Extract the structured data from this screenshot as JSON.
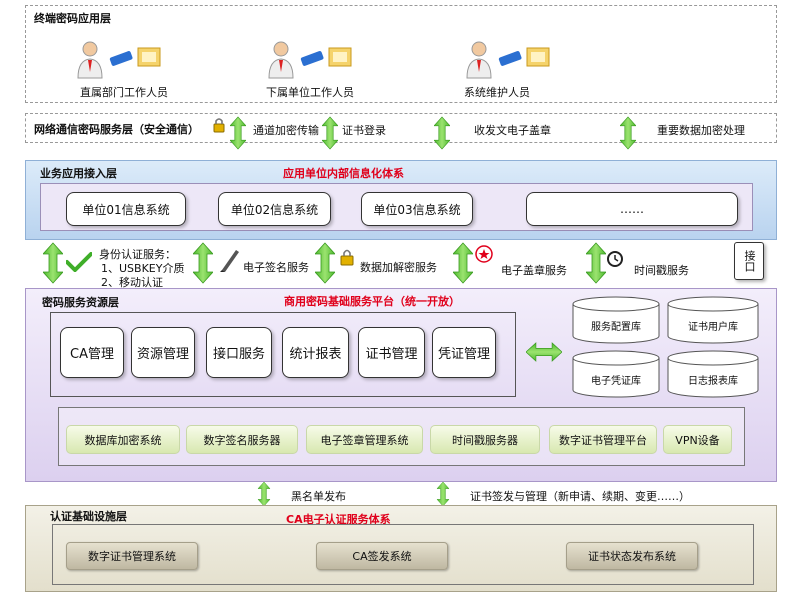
{
  "terminal_layer": {
    "title": "终端密码应用层",
    "users": [
      "直属部门工作人员",
      "下属单位工作人员",
      "系统维护人员"
    ]
  },
  "network_layer": {
    "title": "网络通信密码服务层（安全通信）",
    "labels": [
      "通道加密传输",
      "证书登录",
      "收发文电子盖章",
      "重要数据加密处理"
    ]
  },
  "business_layer": {
    "title": "业务应用接入层",
    "subtitle": "应用单位内部信息化体系",
    "systems": [
      "单位01信息系统",
      "单位02信息系统",
      "单位03信息系统",
      "……"
    ]
  },
  "middle_services": {
    "auth": [
      "身份认证服务：",
      "1、USBKEY介质",
      "2、移动认证"
    ],
    "signature": "电子签名服务",
    "encryption": "数据加解密服务",
    "seal": "电子盖章服务",
    "timestamp": "时间戳服务",
    "interface": "接口"
  },
  "crypto_layer": {
    "title": "密码服务资源层",
    "subtitle": "商用密码基础服务平台（统一开放）",
    "management": [
      "CA管理",
      "资源管理",
      "接口服务",
      "统计报表",
      "证书管理",
      "凭证管理"
    ],
    "databases": [
      "服务配置库",
      "证书用户库",
      "电子凭证库",
      "日志报表库"
    ],
    "servers": [
      "数据库加密系统",
      "数字签名服务器",
      "电子签章管理系统",
      "时间戳服务器",
      "数字证书管理平台",
      "VPN设备"
    ]
  },
  "bottom_links": [
    "黑名单发布",
    "证书签发与管理（新申请、续期、变更……）"
  ],
  "cert_layer": {
    "title": "认证基础设施层",
    "subtitle": "CA电子认证服务体系",
    "systems": [
      "数字证书管理系统",
      "CA签发系统",
      "证书状态发布系统"
    ]
  },
  "colors": {
    "arrow_green": "#7ed957",
    "blue_band": "#c7ddf3",
    "purple_panel": "#e6ddf5",
    "tan_panel": "#ece8da",
    "red_text": "#e0001b"
  }
}
